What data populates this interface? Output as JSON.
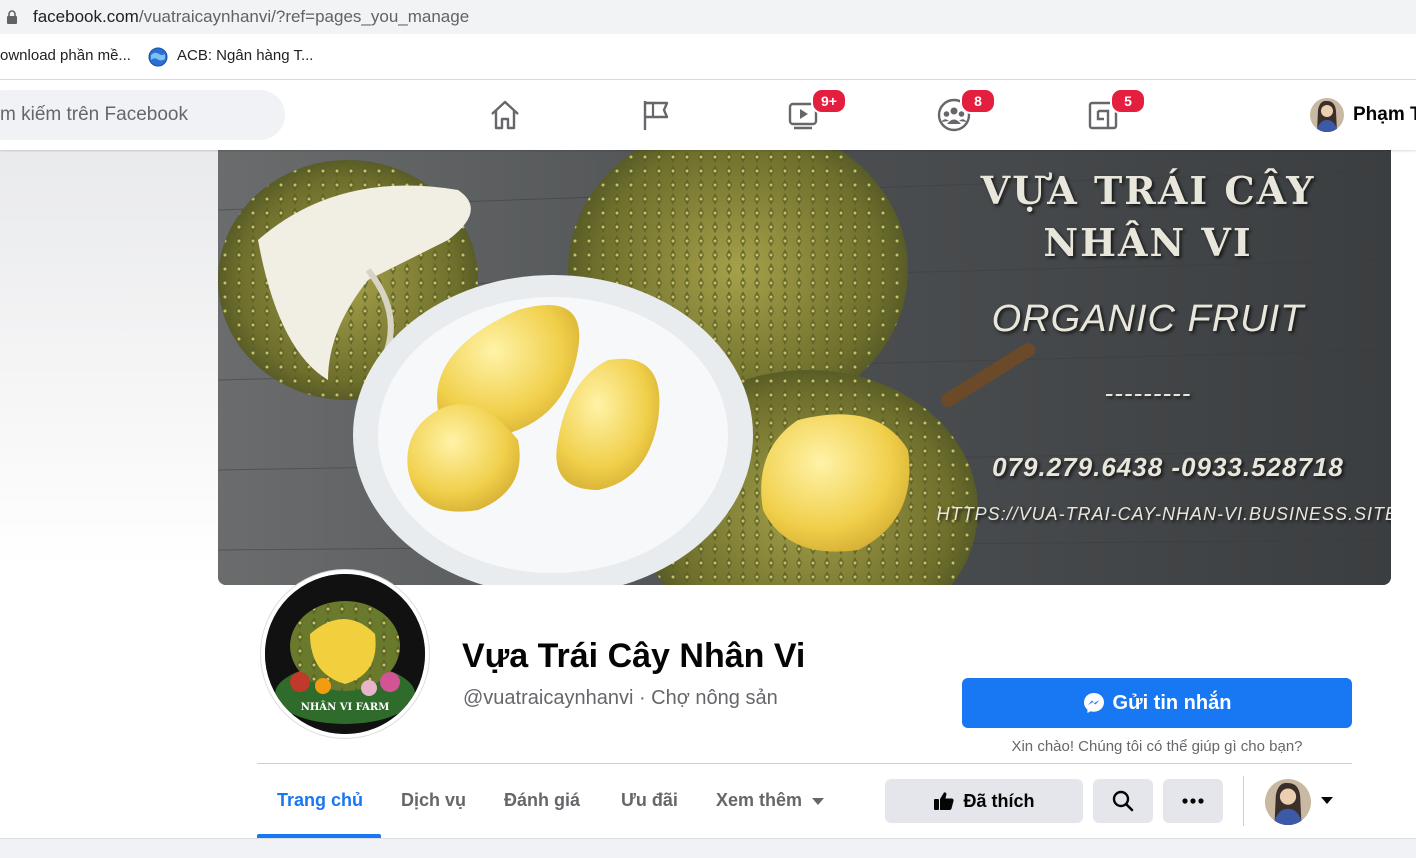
{
  "browser": {
    "url_domain": "facebook.com",
    "url_path": "/vuatraicaynhanvi/?ref=pages_you_manage",
    "bookmarks": [
      {
        "label": "ownload phần mề..."
      },
      {
        "label": "ACB: Ngân hàng T..."
      }
    ]
  },
  "nav": {
    "search_placeholder": "m kiếm trên Facebook",
    "icons": [
      {
        "name": "home-icon",
        "badge": ""
      },
      {
        "name": "flag-icon",
        "badge": ""
      },
      {
        "name": "watch-icon",
        "badge": "9+"
      },
      {
        "name": "groups-icon",
        "badge": "8"
      },
      {
        "name": "gaming-icon",
        "badge": "5"
      }
    ],
    "user_name": "Phạm T"
  },
  "cover": {
    "line1": "VỰA TRÁI CÂY",
    "line2": "NHÂN VI",
    "tagline": "ORGANIC FRUIT",
    "dashes": "---------",
    "phones": "079.279.6438 -0933.528718",
    "website": "HTTPS://VUA-TRAI-CAY-NHAN-VI.BUSINESS.SITE"
  },
  "profile": {
    "logo_text": "NHÂN VI FARM",
    "title": "Vựa Trái Cây Nhân Vi",
    "subtitle": "@vuatraicaynhanvi · Chợ nông sản"
  },
  "actions": {
    "message_label": "Gửi tin nhắn",
    "message_hint": "Xin chào! Chúng tôi có thể giúp gì cho bạn?",
    "liked_label": "Đã thích"
  },
  "tabs": [
    {
      "label": "Trang chủ",
      "active": true
    },
    {
      "label": "Dịch vụ"
    },
    {
      "label": "Đánh giá"
    },
    {
      "label": "Ưu đãi"
    },
    {
      "label": "Xem thêm"
    }
  ],
  "colors": {
    "brand": "#1877f2",
    "badge": "#e41e3f"
  }
}
